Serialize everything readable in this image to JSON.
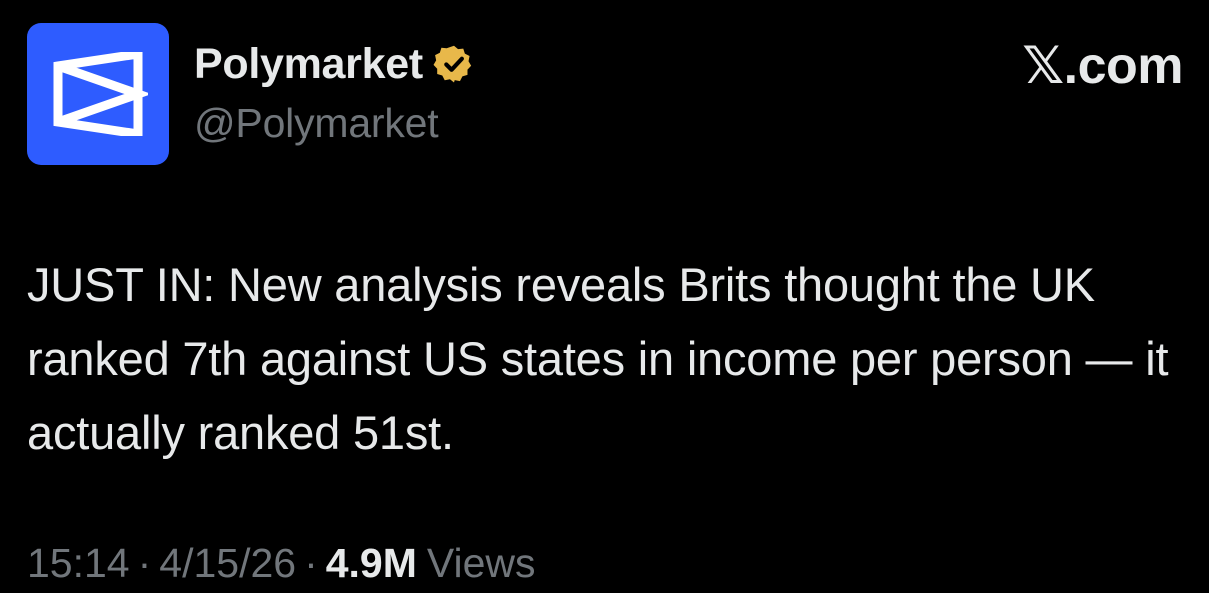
{
  "author": {
    "display_name": "Polymarket",
    "handle": "@Polymarket",
    "avatar_icon": "polymarket-logo-icon",
    "avatar_color": "#2e5cff",
    "verified_icon": "verified-badge-icon",
    "verified_color": "#e8b84a"
  },
  "brand": {
    "label": "𝕏.com"
  },
  "tweet": {
    "text": "JUST IN: New analysis reveals Brits thought the UK ranked 7th against US states in income per person — it actually ranked 51st."
  },
  "meta": {
    "time": "15:14",
    "separator": "·",
    "date": "4/15/26",
    "views_count": "4.9M",
    "views_label": "Views"
  }
}
